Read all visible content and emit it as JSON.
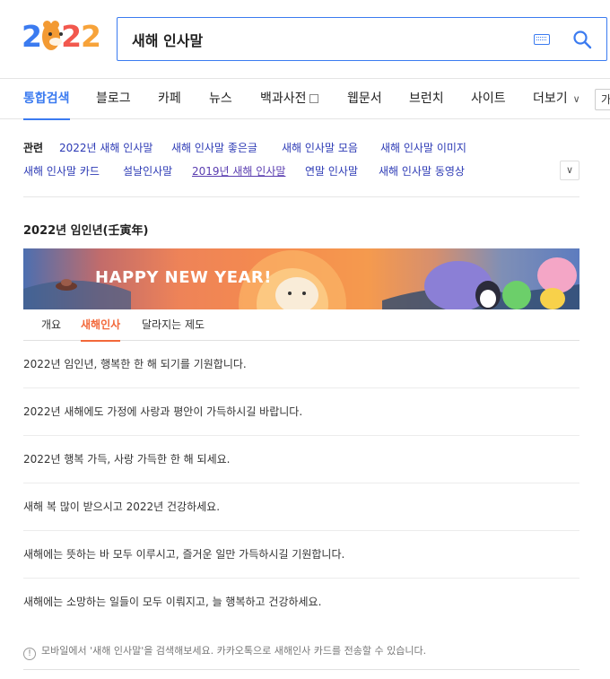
{
  "header": {
    "logo": "2022",
    "search": {
      "value": "새해 인사말"
    }
  },
  "tabs": [
    {
      "label": "통합검색",
      "active": true
    },
    {
      "label": "블로그"
    },
    {
      "label": "카페"
    },
    {
      "label": "뉴스"
    },
    {
      "label": "백과사전"
    },
    {
      "label": "웹문서"
    },
    {
      "label": "브런치"
    },
    {
      "label": "사이트"
    },
    {
      "label": "더보기"
    },
    {
      "label": "가"
    }
  ],
  "related": {
    "label": "관련",
    "terms": [
      "2022년 새해 인사말",
      "새해 인사말 좋은글",
      "새해 인사말 모음",
      "새해 인사말 이미지",
      "새해 인사말 카드",
      "설날인사말",
      "2019년 새해 인사말",
      "연말 인사말",
      "새해 인사말 동영상"
    ]
  },
  "section": {
    "title": "2022년 임인년(壬寅年)",
    "banner_text": "HAPPY NEW YEAR!",
    "subtabs": [
      "개요",
      "새해인사",
      "달라지는 제도"
    ],
    "active_subtab": "새해인사",
    "greetings": [
      "2022년 임인년, 행복한 한 해 되기를 기원합니다.",
      "2022년 새해에도 가정에 사랑과 평안이 가득하시길 바랍니다.",
      "2022년 행복 가득, 사랑 가득한 한 해 되세요.",
      "새해 복 많이 받으시고 2022년 건강하세요.",
      "새해에는 뜻하는 바 모두 이루시고, 즐거운 일만 가득하시길 기원합니다.",
      "새해에는 소망하는 일들이 모두 이뤄지고, 늘 행복하고 건강하세요."
    ],
    "notice": "모바일에서 '새해 인사말'을 검색해보세요. 카카오톡으로 새해인사 카드를 전송할 수 있습니다."
  },
  "colors": {
    "accent": "#3b7bf0",
    "link": "#2c3ab5",
    "subtab_active": "#f2683a"
  }
}
